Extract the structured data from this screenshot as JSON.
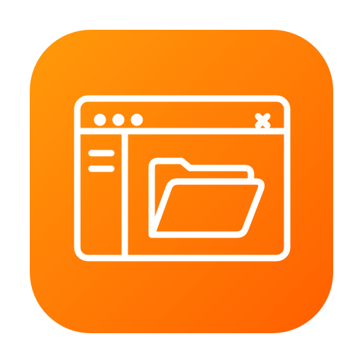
{
  "icon": {
    "name": "file-browser-app-icon",
    "glyph": "folder-window-icon",
    "colors": {
      "gradient_start": "#FF9A0A",
      "gradient_end": "#FF5F00",
      "stroke": "#FFFFFF",
      "background": "#FFFFFF"
    }
  }
}
